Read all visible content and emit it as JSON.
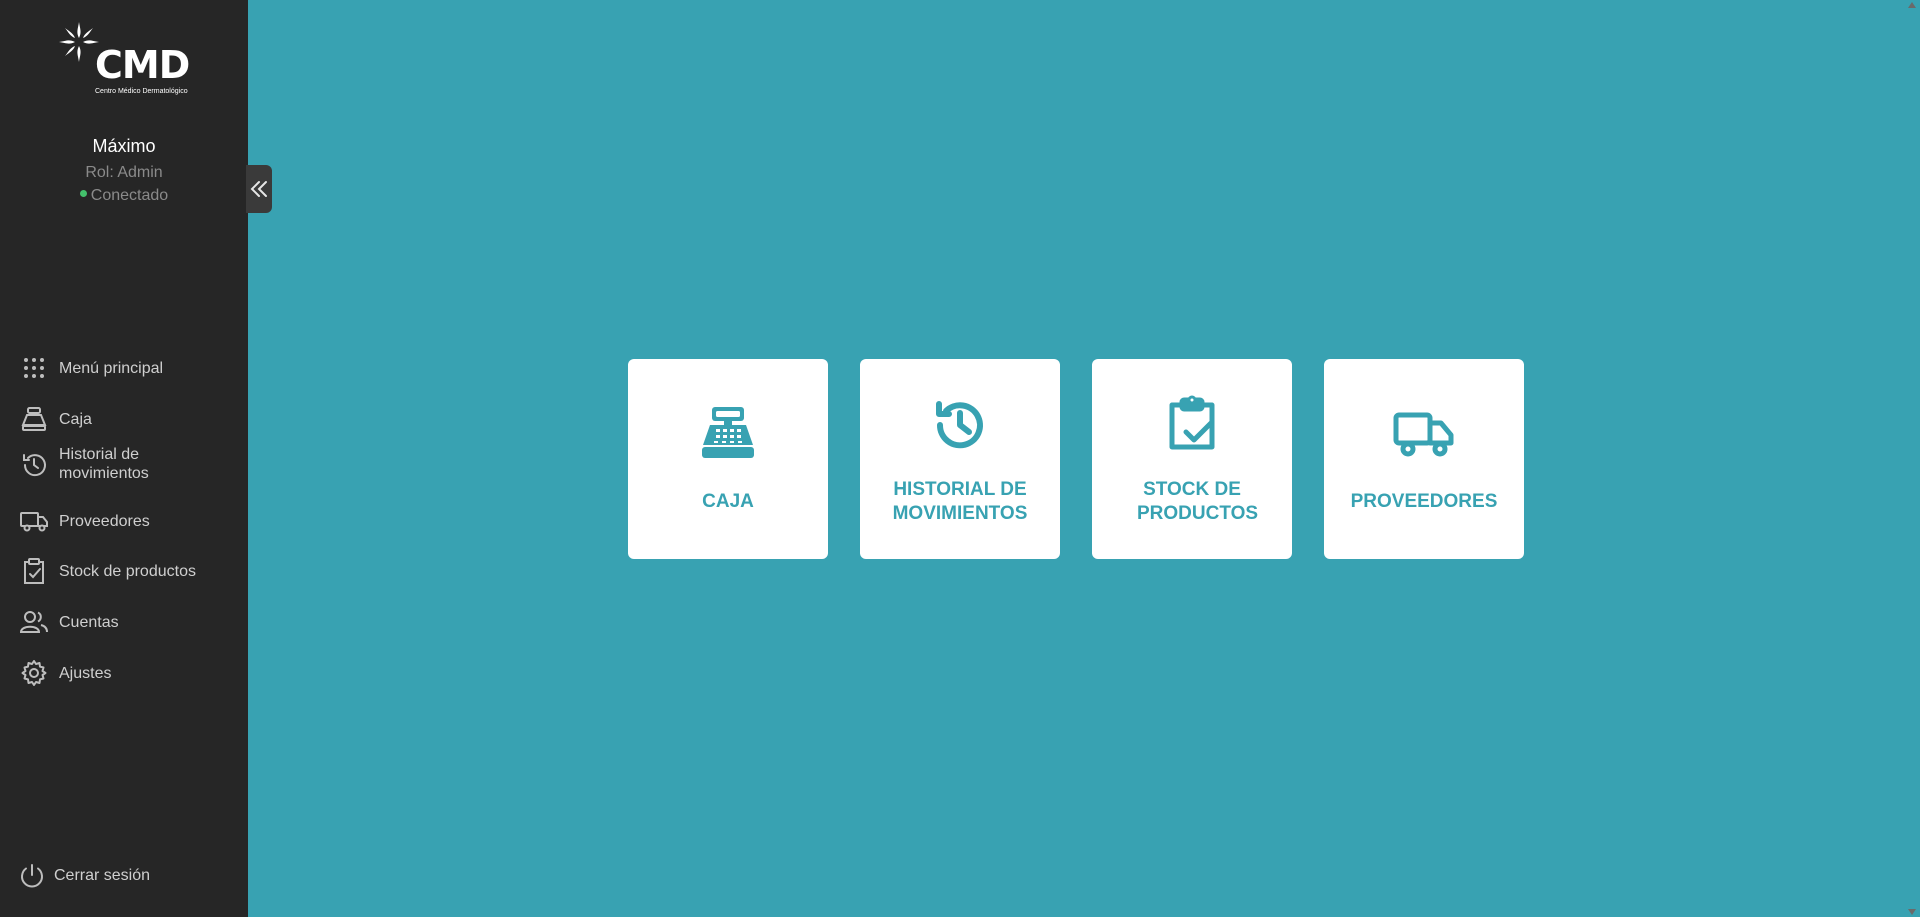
{
  "brand": {
    "name": "CMD",
    "subtitle": "Centro Médico Dermatológico"
  },
  "user": {
    "name": "Máximo",
    "role": "Rol: Admin",
    "status": "Conectado"
  },
  "sidebar": {
    "items": [
      {
        "label": "Menú principal",
        "icon": "grid-dots-icon"
      },
      {
        "label": "Caja",
        "icon": "cash-register-icon"
      },
      {
        "label": "Historial de movimientos",
        "icon": "history-icon"
      },
      {
        "label": "Proveedores",
        "icon": "truck-icon"
      },
      {
        "label": "Stock de productos",
        "icon": "clipboard-check-icon"
      },
      {
        "label": "Cuentas",
        "icon": "users-icon"
      },
      {
        "label": "Ajustes",
        "icon": "gear-icon"
      }
    ],
    "logout_label": "Cerrar sesión"
  },
  "cards": [
    {
      "label": "CAJA",
      "icon": "cash-register-icon"
    },
    {
      "label": "HISTORIAL DE MOVIMIENTOS",
      "icon": "history-icon"
    },
    {
      "label": "STOCK DE PRODUCTOS",
      "icon": "clipboard-check-icon"
    },
    {
      "label": "PROVEEDORES",
      "icon": "truck-icon"
    }
  ],
  "colors": {
    "accent": "#38a2b2",
    "sidebar_bg": "#262626",
    "status_online": "#43c06b"
  }
}
